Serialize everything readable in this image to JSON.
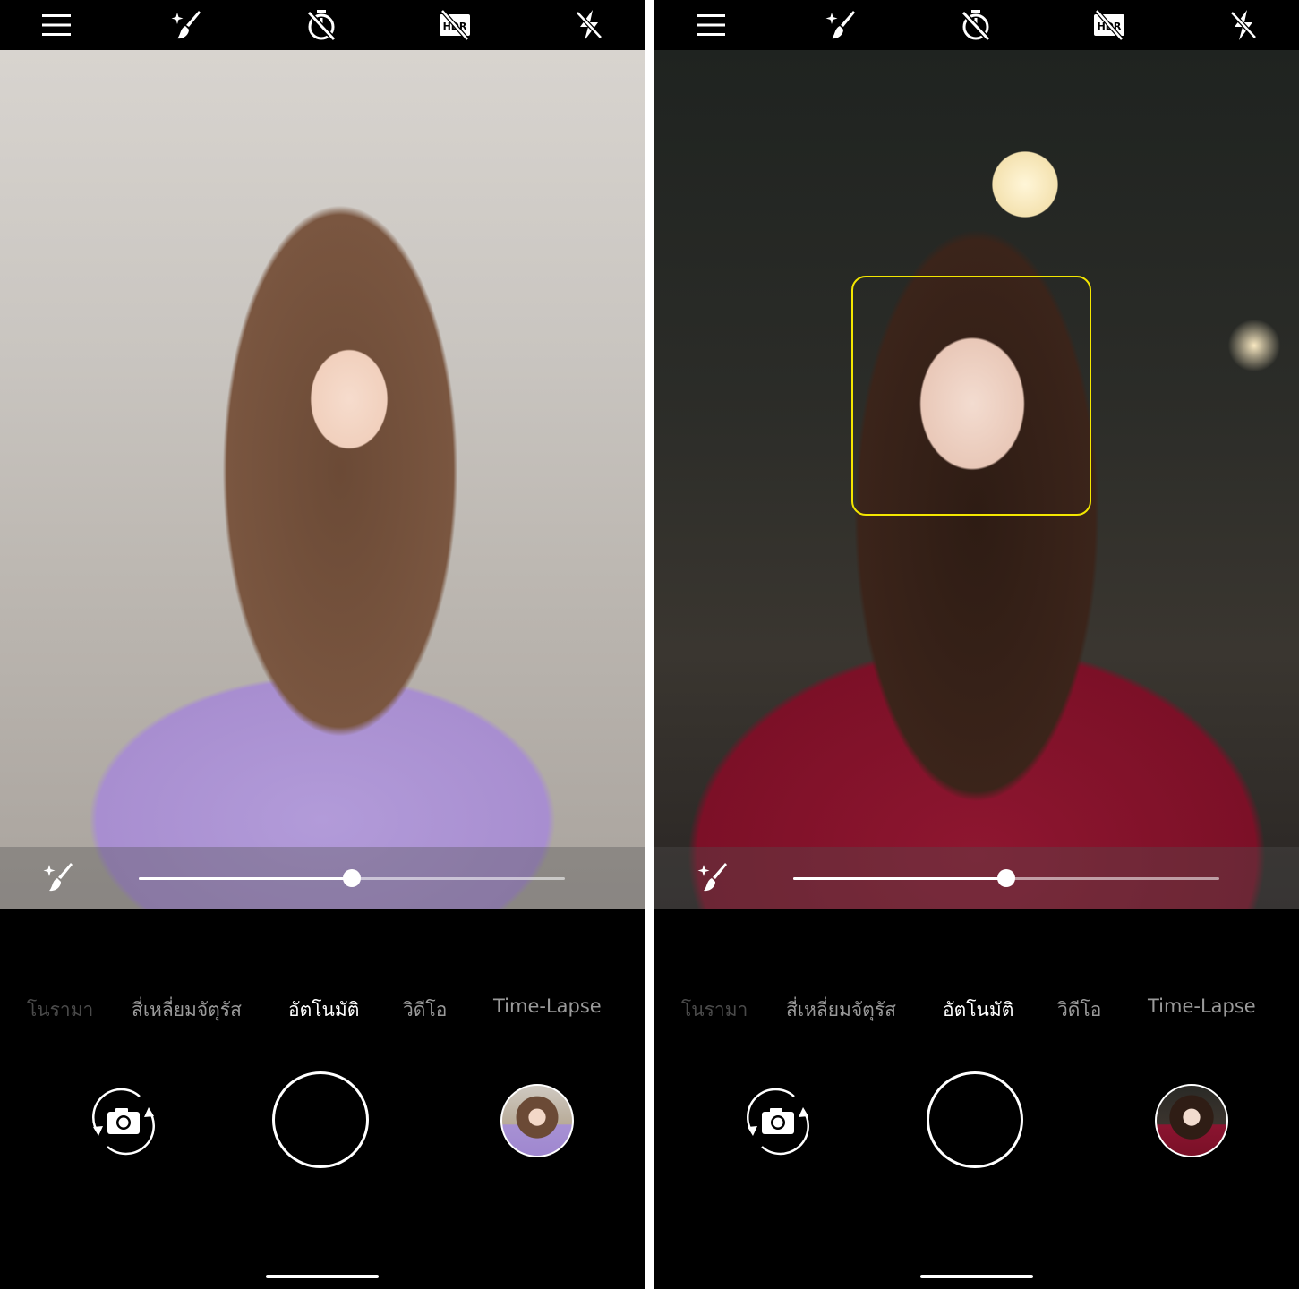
{
  "screens": [
    {
      "id": "left",
      "top_icons": [
        "menu-icon",
        "beauty-wand-icon",
        "timer-off-icon",
        "hdr-off-icon",
        "flash-off-icon"
      ],
      "viewfinder": {
        "face_detected": false,
        "scene": "woman in lavender top, bright cafe"
      },
      "beauty_slider": {
        "value": 0.5
      },
      "modes": [
        {
          "label": "โนรามา"
        },
        {
          "label": "สี่เหลี่ยมจัตุรัส"
        },
        {
          "label": "อัตโนมัติ"
        },
        {
          "label": "วิดีโอ"
        },
        {
          "label": "Time-Lapse"
        }
      ],
      "active_mode": "อัตโนมัติ",
      "bottom_controls": {
        "switch_icon": "camera-switch-icon",
        "shutter": "shutter-button",
        "gallery": "gallery-thumbnail"
      }
    },
    {
      "id": "right",
      "top_icons": [
        "menu-icon",
        "beauty-wand-icon",
        "timer-off-icon",
        "hdr-off-icon",
        "flash-off-icon"
      ],
      "viewfinder": {
        "face_detected": true,
        "scene": "woman in red top, dim cafe"
      },
      "beauty_slider": {
        "value": 0.5
      },
      "modes": [
        {
          "label": "โนรามา"
        },
        {
          "label": "สี่เหลี่ยมจัตุรัส"
        },
        {
          "label": "อัตโนมัติ"
        },
        {
          "label": "วิดีโอ"
        },
        {
          "label": "Time-Lapse"
        }
      ],
      "active_mode": "อัตโนมัติ",
      "bottom_controls": {
        "switch_icon": "camera-switch-icon",
        "shutter": "shutter-button",
        "gallery": "gallery-thumbnail"
      }
    }
  ],
  "colors": {
    "background": "#000000",
    "face_box": "#f3e600",
    "mode_inactive": "#9a9a9a",
    "mode_active": "#ffffff"
  }
}
